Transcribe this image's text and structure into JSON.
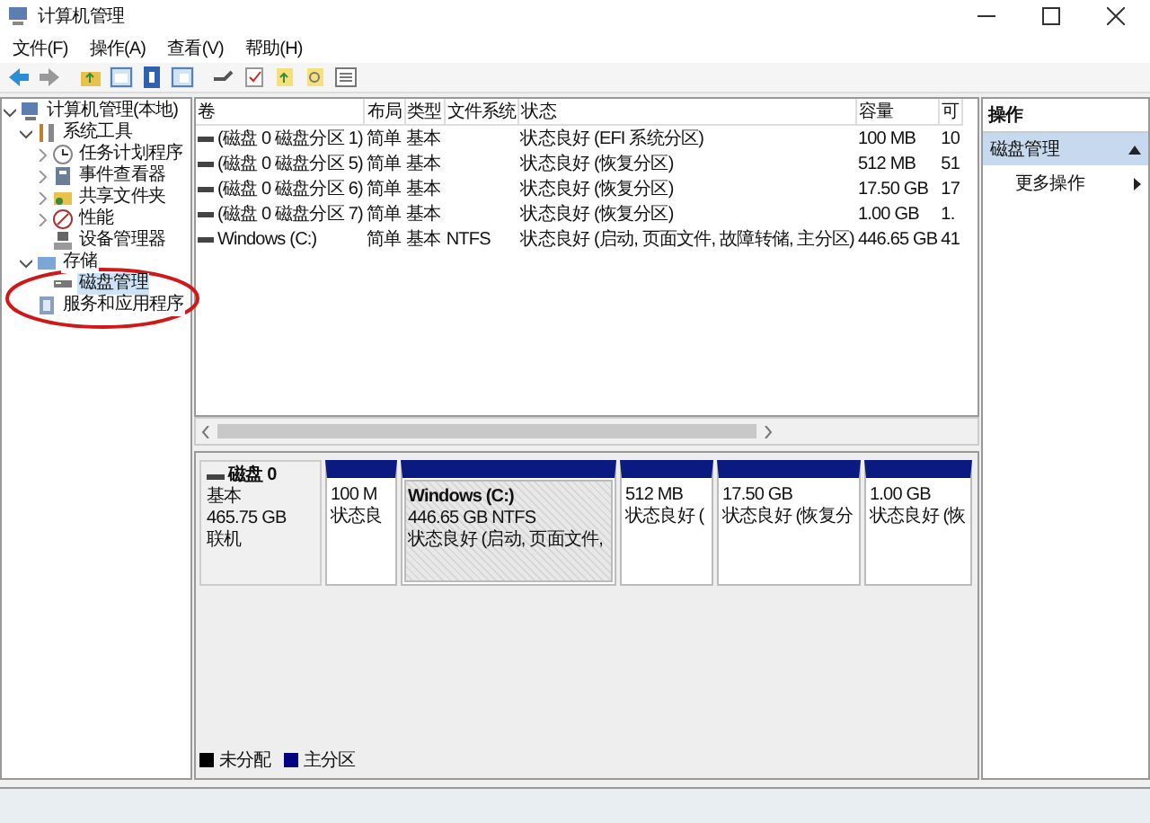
{
  "window": {
    "title": "计算机管理"
  },
  "menu": [
    "文件(F)",
    "操作(A)",
    "查看(V)",
    "帮助(H)"
  ],
  "tree": [
    {
      "label": "计算机管理(本地)",
      "kind": "computer",
      "expanded": true,
      "selected": false,
      "children": [
        {
          "label": "系统工具",
          "kind": "tools",
          "expanded": true,
          "selected": false,
          "children": [
            {
              "label": "任务计划程序",
              "kind": "scheduler",
              "expanded": false,
              "selected": false
            },
            {
              "label": "事件查看器",
              "kind": "events",
              "expanded": false,
              "selected": false
            },
            {
              "label": "共享文件夹",
              "kind": "shares",
              "expanded": false,
              "selected": false
            },
            {
              "label": "性能",
              "kind": "performance",
              "expanded": false,
              "selected": false
            },
            {
              "label": "设备管理器",
              "kind": "devices",
              "selected": false
            }
          ]
        },
        {
          "label": "存储",
          "kind": "storage",
          "expanded": true,
          "selected": false,
          "children": [
            {
              "label": "磁盘管理",
              "kind": "disks",
              "selected": true
            }
          ]
        },
        {
          "label": "服务和应用程序",
          "kind": "services",
          "selected": false
        }
      ]
    }
  ],
  "table": {
    "columns": [
      "卷",
      "布局",
      "类型",
      "文件系统",
      "状态",
      "容量",
      "可"
    ],
    "rows": [
      [
        "(磁盘 0 磁盘分区 1)",
        "简单",
        "基本",
        "",
        "状态良好 (EFI 系统分区)",
        "100 MB",
        "10"
      ],
      [
        "(磁盘 0 磁盘分区 5)",
        "简单",
        "基本",
        "",
        "状态良好 (恢复分区)",
        "512 MB",
        "51"
      ],
      [
        "(磁盘 0 磁盘分区 6)",
        "简单",
        "基本",
        "",
        "状态良好 (恢复分区)",
        "17.50 GB",
        "17"
      ],
      [
        "(磁盘 0 磁盘分区 7)",
        "简单",
        "基本",
        "",
        "状态良好 (恢复分区)",
        "1.00 GB",
        "1."
      ],
      [
        "Windows (C:)",
        "简单",
        "基本",
        "NTFS",
        "状态良好 (启动, 页面文件, 故障转储, 主分区)",
        "446.65 GB",
        "41"
      ]
    ]
  },
  "disk": {
    "name": "磁盘 0",
    "type": "基本",
    "size": "465.75 GB",
    "status": "联机",
    "partitions": [
      {
        "size": "100 M",
        "status": "状态良",
        "selected": false
      },
      {
        "name": "Windows  (C:)",
        "size": "446.65 GB NTFS",
        "status": "状态良好 (启动, 页面文件,",
        "selected": true
      },
      {
        "size": "512 MB",
        "status": "状态良好 (",
        "selected": false
      },
      {
        "size": "17.50 GB",
        "status": "状态良好 (恢复分",
        "selected": false
      },
      {
        "size": "1.00 GB",
        "status": "状态良好 (恢",
        "selected": false
      }
    ]
  },
  "legend": [
    {
      "label": "未分配",
      "color": "#000000"
    },
    {
      "label": "主分区",
      "color": "#000080"
    }
  ],
  "actions": {
    "header": "操作",
    "section": "磁盘管理",
    "expanded": true,
    "items": [
      "更多操作"
    ]
  }
}
